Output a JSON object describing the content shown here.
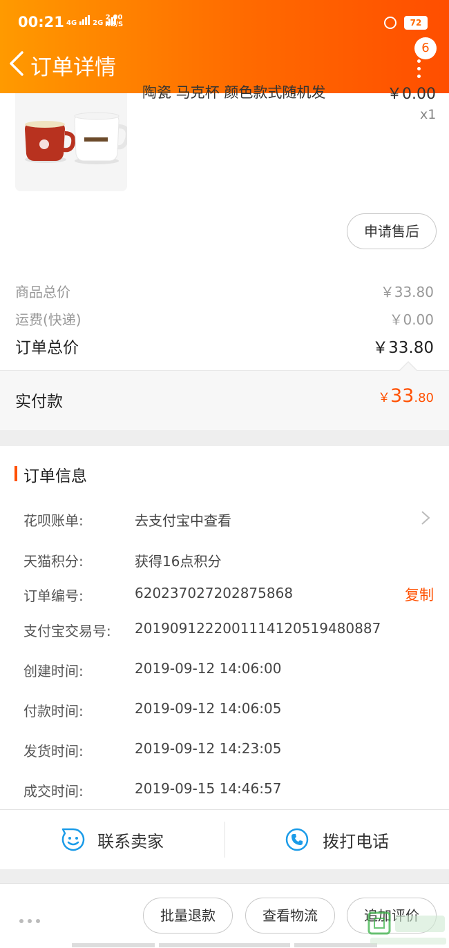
{
  "status_bar": {
    "time": "00:21",
    "net1": "4G",
    "net2": "2G",
    "speed_top": "2.00",
    "speed_unit": "KB/S",
    "battery": "72"
  },
  "header": {
    "title": "订单详情",
    "badge": "6"
  },
  "product": {
    "title": "陶瓷 马克杯 颜色款式随机发",
    "price": "￥0.00",
    "qty": "x1",
    "after_sale": "申请售后"
  },
  "summary": {
    "goods_label": "商品总价",
    "goods_value": "￥33.80",
    "shipping_label": "运费(快递)",
    "shipping_value": "￥0.00",
    "total_label": "订单总价",
    "total_value": "￥33.80",
    "paid_label": "实付款",
    "paid_currency": "￥",
    "paid_int": "33",
    "paid_dec": ".80"
  },
  "order_info": {
    "title": "订单信息",
    "copy_label": "复制",
    "rows": [
      {
        "label": "花呗账单:",
        "value": "去支付宝中查看"
      },
      {
        "label": "天猫积分:",
        "value": "获得16点积分"
      },
      {
        "label": "订单编号:",
        "value": "620237027202875868"
      },
      {
        "label": "支付宝交易号:",
        "value": "2019091222001114120519480887"
      },
      {
        "label": "创建时间:",
        "value": "2019-09-12 14:06:00"
      },
      {
        "label": "付款时间:",
        "value": "2019-09-12 14:06:05"
      },
      {
        "label": "发货时间:",
        "value": "2019-09-12 14:23:05"
      },
      {
        "label": "成交时间:",
        "value": "2019-09-15 14:46:57"
      }
    ]
  },
  "contact": {
    "seller": "联系卖家",
    "phone": "拨打电话"
  },
  "bottom_actions": {
    "refund": "批量退款",
    "logistics": "查看物流",
    "review": "追加评价"
  },
  "colors": {
    "brand_orange": "#ff5000",
    "header_start": "#ff9a00",
    "header_end": "#ff4e00",
    "icon_blue": "#1a9be8"
  },
  "icons": [
    "back-icon",
    "more-icon",
    "chevron-right-icon",
    "smile-chat-icon",
    "phone-icon",
    "ellipsis-icon"
  ]
}
